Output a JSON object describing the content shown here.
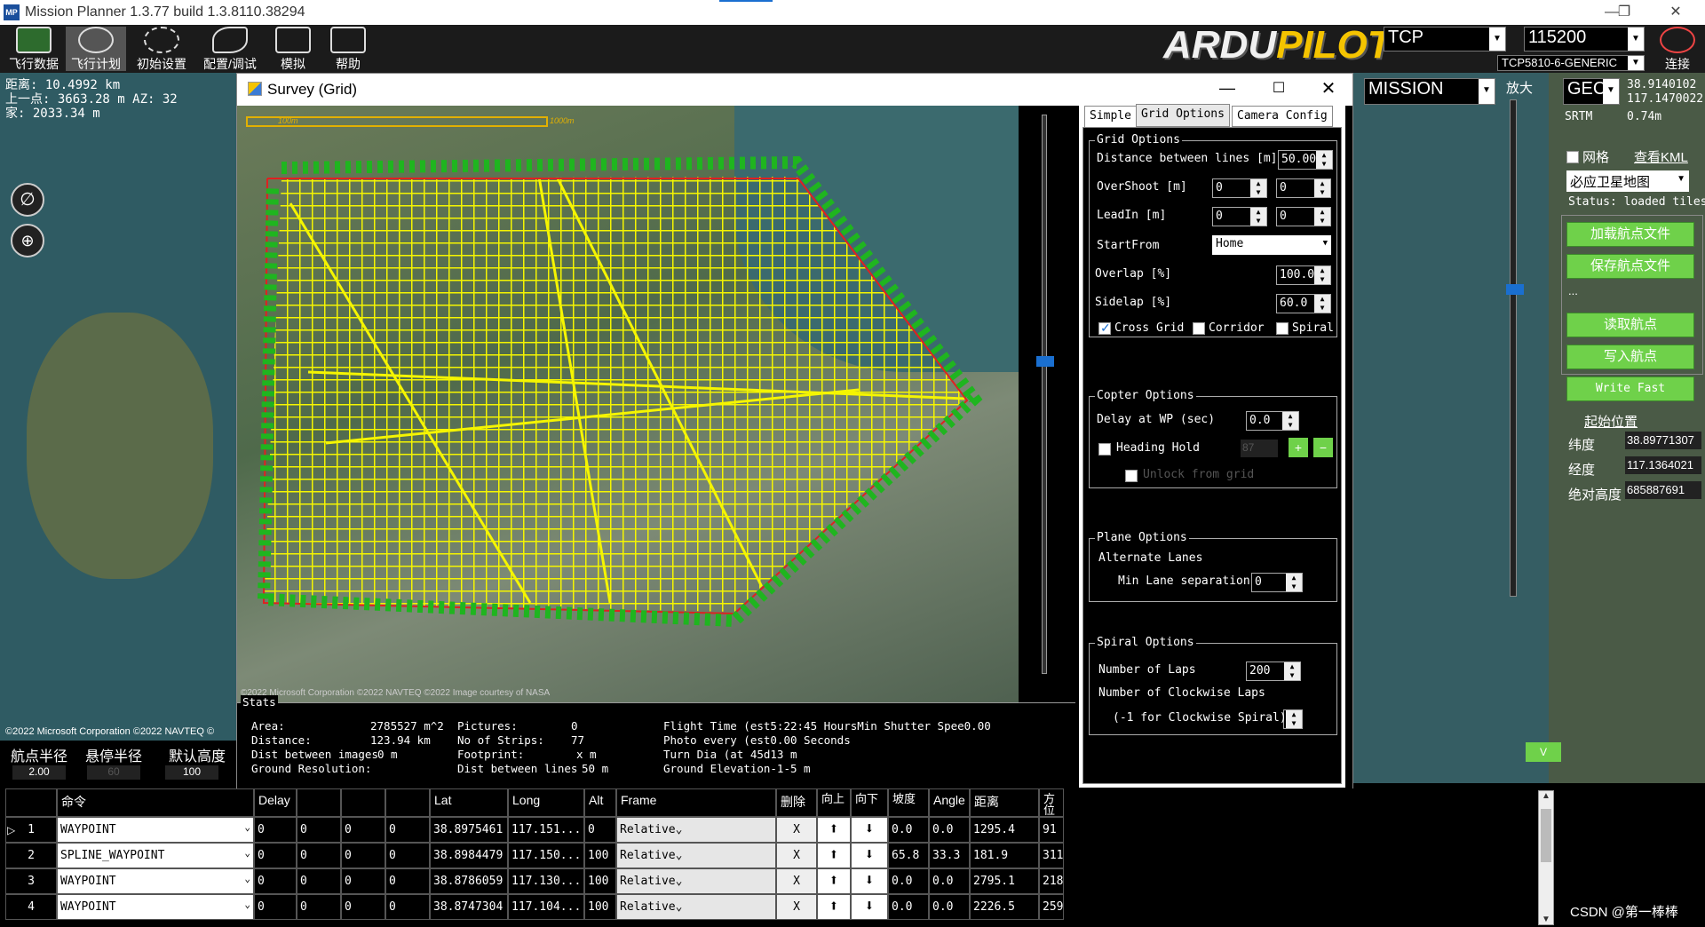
{
  "app": {
    "title": "Mission Planner 1.3.77 build 1.3.8110.38294",
    "icon_text": "MP"
  },
  "toolbar": {
    "items": [
      {
        "label": "飞行数据",
        "icon": "flight-data-icon"
      },
      {
        "label": "飞行计划",
        "icon": "flight-plan-icon"
      },
      {
        "label": "初始设置",
        "icon": "initial-setup-icon"
      },
      {
        "label": "配置/调试",
        "icon": "config-tuning-icon"
      },
      {
        "label": "模拟",
        "icon": "simulation-icon"
      },
      {
        "label": "帮助",
        "icon": "help-icon"
      }
    ],
    "logo_a": "ARDU",
    "logo_b": "PILOT",
    "connection_type": "TCP",
    "baud": "115200",
    "device": "TCP5810-6-GENERIC",
    "connect_label": "连接"
  },
  "map_info": {
    "distance": "距离: 10.4992 km",
    "prev_point": "上一点: 3663.28 m AZ: 32",
    "home": "家: 2033.34 m",
    "copyright": "©2022 Microsoft Corporation ©2022 NAVTEQ ©"
  },
  "right_panel": {
    "mode": "MISSION",
    "zoom_label": "放大",
    "geo_label": "GEC",
    "lat_value": "38.9140102",
    "lng_value": "117.1470022",
    "srtm_label": "SRTM",
    "srtm_value": "0.74m",
    "grid_label": "网格",
    "view_kml": "查看KML",
    "map_type": "必应卫星地图",
    "status": "Status: loaded tiles",
    "load_wp": "加载航点文件",
    "save_wp": "保存航点文件",
    "dots": "...",
    "read_wp": "读取航点",
    "write_wp": "写入航点",
    "write_fast": "Write Fast",
    "home_title": "起始位置",
    "home_lat_label": "纬度",
    "home_lat": "38.89771307",
    "home_lng_label": "经度",
    "home_lng": "117.1364021",
    "home_alt_label": "绝对高度",
    "home_alt": "685887691",
    "v_button": "V",
    "watermark": "CSDN @第一棒棒"
  },
  "left_panel": {
    "wp_radius_label": "航点半径",
    "loiter_radius_label": "悬停半径",
    "default_alt_label": "默认高度",
    "wp_radius": "2.00",
    "loiter_radius": "60",
    "default_alt": "100"
  },
  "survey": {
    "title": "Survey (Grid)",
    "scale_a": "100m",
    "scale_b": "1000m",
    "map_copyright": "©2022 Microsoft Corporation ©2022 NAVTEQ ©2022 Image courtesy of NASA",
    "tabs": [
      "Simple",
      "Grid Options",
      "Camera Config"
    ],
    "grid_options": {
      "title": "Grid Options",
      "distance_lines_label": "Distance between lines [m]",
      "distance_lines": "50.00",
      "overshoot_label": "OverShoot [m]",
      "overshoot_a": "0",
      "overshoot_b": "0",
      "leadin_label": "LeadIn [m]",
      "leadin_a": "0",
      "leadin_b": "0",
      "startfrom_label": "StartFrom",
      "startfrom": "Home",
      "overlap_label": "Overlap [%]",
      "overlap": "100.0",
      "sidelap_label": "Sidelap [%]",
      "sidelap": "60.0",
      "crossgrid": "Cross Grid",
      "corridor": "Corridor",
      "spiral": "Spiral"
    },
    "copter_options": {
      "title": "Copter Options",
      "delay_label": "Delay at WP (sec)",
      "delay": "0.0",
      "heading_hold": "Heading Hold",
      "heading_value": "87",
      "unlock": "Unlock from grid"
    },
    "plane_options": {
      "title": "Plane Options",
      "alt_lanes": "Alternate Lanes",
      "min_lane": "Min Lane separation",
      "min_lane_value": "0"
    },
    "spiral_options": {
      "title": "Spiral Options",
      "laps_label": "Number of Laps",
      "laps": "200",
      "cw_laps_label": "Number of Clockwise Laps",
      "cw_hint": "(-1 for Clockwise Spiral)"
    },
    "stats": {
      "title": "Stats",
      "area_label": "Area:",
      "area": "2785527 m^2",
      "distance_label": "Distance:",
      "distance": "123.94 km",
      "dist_images_label": "Dist between images",
      "dist_images": "0 m",
      "ground_res_label": "Ground Resolution:",
      "pictures_label": "Pictures:",
      "pictures": "0",
      "strips_label": "No of Strips:",
      "strips": "77",
      "footprint_label": "Footprint:",
      "footprint": "x m",
      "dist_lines_label": "Dist between lines",
      "dist_lines": "50 m",
      "flight_time": "Flight Time (est5:22:45 HoursMin Shutter Spee0.00",
      "photo_every": "Photo every (est0.00 Seconds",
      "turn_dia": "Turn Dia (at 45d13 m",
      "ground_elev": "Ground Elevation-1-5 m"
    }
  },
  "table": {
    "headers": [
      "",
      "命令",
      "Delay",
      "",
      "",
      "",
      "Lat",
      "Long",
      "Alt",
      "Frame",
      "删除",
      "向上",
      "向下",
      "坡度",
      "Angle",
      "距离",
      "方位"
    ],
    "rows": [
      {
        "n": "1",
        "cmd": "WAYPOINT",
        "p1": "0",
        "p2": "0",
        "p3": "0",
        "p4": "0",
        "lat": "38.8975461",
        "lng": "117.151...",
        "alt": "0",
        "frame": "Relative",
        "del": "X",
        "grad": "0.0",
        "angle": "0.0",
        "dist": "1295.4",
        "az": "91"
      },
      {
        "n": "2",
        "cmd": "SPLINE_WAYPOINT",
        "p1": "0",
        "p2": "0",
        "p3": "0",
        "p4": "0",
        "lat": "38.8984479",
        "lng": "117.150...",
        "alt": "100",
        "frame": "Relative",
        "del": "X",
        "grad": "65.8",
        "angle": "33.3",
        "dist": "181.9",
        "az": "311"
      },
      {
        "n": "3",
        "cmd": "WAYPOINT",
        "p1": "0",
        "p2": "0",
        "p3": "0",
        "p4": "0",
        "lat": "38.8786059",
        "lng": "117.130...",
        "alt": "100",
        "frame": "Relative",
        "del": "X",
        "grad": "0.0",
        "angle": "0.0",
        "dist": "2795.1",
        "az": "218"
      },
      {
        "n": "4",
        "cmd": "WAYPOINT",
        "p1": "0",
        "p2": "0",
        "p3": "0",
        "p4": "0",
        "lat": "38.8747304",
        "lng": "117.104...",
        "alt": "100",
        "frame": "Relative",
        "del": "X",
        "grad": "0.0",
        "angle": "0.0",
        "dist": "2226.5",
        "az": "259"
      }
    ]
  },
  "colors": {
    "grid_line": "#f5f500",
    "marker": "#1fb51f",
    "boundary": "#e02020",
    "accent_green": "#6fd14a"
  }
}
